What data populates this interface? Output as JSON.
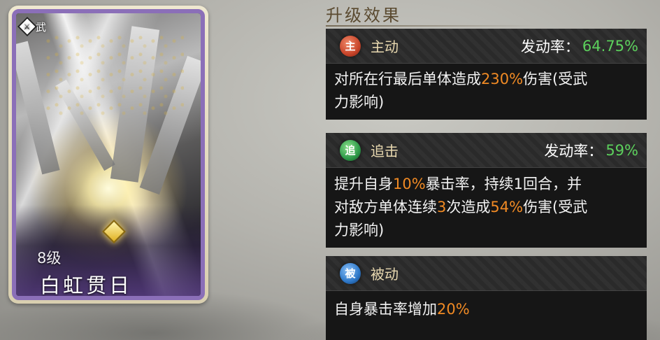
{
  "card": {
    "type_badge": "武",
    "type_badge_icon": "sword-diamond-icon",
    "level": "8级",
    "skill_name": "白虹贯日",
    "frame_color": "#8b6fb8"
  },
  "panel": {
    "title": "升级效果",
    "skills": [
      {
        "icon_char": "主",
        "icon_color": "#c8452a",
        "type_label": "主动",
        "rate_label": "发动率：",
        "rate_value": "64.75%",
        "desc_line1_a": "对所在行最后单体造成",
        "desc_line1_hl": "230%",
        "desc_line1_b": "伤害(受武",
        "desc_line2": "力影响)"
      },
      {
        "icon_char": "追",
        "icon_color": "#2f9a4a",
        "type_label": "追击",
        "rate_label": "发动率：",
        "rate_value": "59%",
        "desc_l1_a": "提升自身",
        "desc_l1_h1": "10%",
        "desc_l1_b": "暴击率，持续1回合，并",
        "desc_l2_a": "对敌方单体连续",
        "desc_l2_h1": "3",
        "desc_l2_b": "次造成",
        "desc_l2_h2": "54%",
        "desc_l2_c": "伤害(受武",
        "desc_l3": "力影响)"
      },
      {
        "icon_char": "被",
        "icon_color": "#2e78c8",
        "type_label": "被动",
        "desc_a": "自身暴击率增加",
        "desc_hl": "20%"
      }
    ]
  },
  "colors": {
    "highlight": "#f08a24",
    "rate": "#5cd05c"
  }
}
